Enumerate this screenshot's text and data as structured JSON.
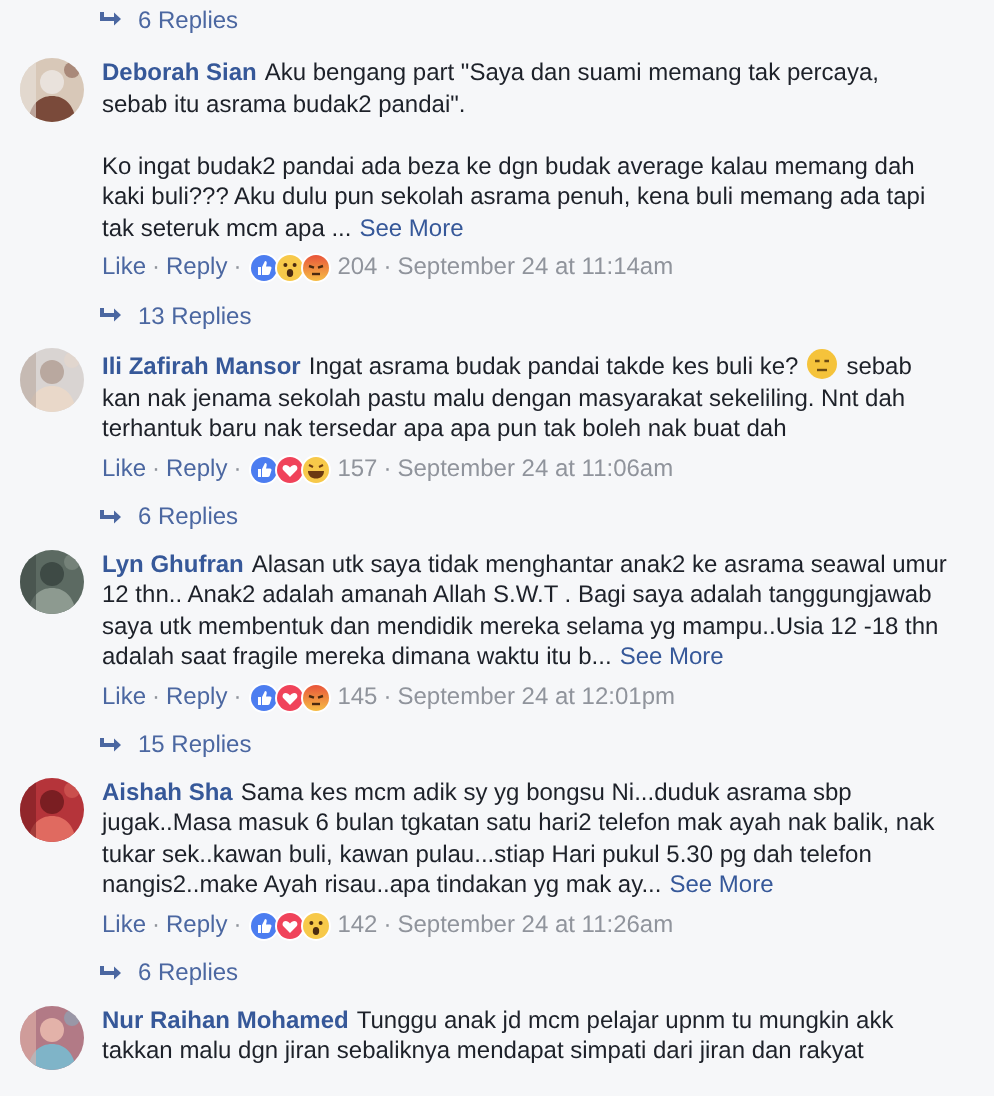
{
  "top_replies": {
    "label": "6 Replies"
  },
  "comments": [
    {
      "author": "Deborah Sian",
      "avatar": {
        "kind": "picture"
      },
      "paragraphs": [
        [
          {
            "kind": "text",
            "text": "Aku bengang part \"Saya dan suami memang tak percaya, sebab itu asrama budak2 pandai\"."
          }
        ],
        [
          {
            "kind": "text",
            "text": "Ko ingat budak2 pandai ada beza ke dgn budak average kalau memang dah kaki buli??? Aku dulu pun sekolah asrama penuh, kena buli memang ada tapi tak seteruk mcm apa ..."
          },
          {
            "kind": "link",
            "text": "See More"
          }
        ]
      ],
      "meta": [
        {
          "kind": "link",
          "text": "Like"
        },
        {
          "kind": "dot",
          "text": "·"
        },
        {
          "kind": "link",
          "text": "Reply"
        },
        {
          "kind": "dot",
          "text": "·"
        },
        {
          "kind": "reactions",
          "icons": [
            {
              "kind": "like"
            },
            {
              "kind": "wow"
            },
            {
              "kind": "angry"
            }
          ],
          "count": "204"
        },
        {
          "kind": "dot",
          "text": "·"
        },
        {
          "kind": "time",
          "text": "September 24 at 11:14am"
        }
      ],
      "replies": "13 Replies"
    },
    {
      "author": "Ili Zafirah Mansor",
      "avatar": {
        "kind": "picture"
      },
      "paragraphs": [
        [
          {
            "kind": "text",
            "text": "Ingat asrama budak pandai takde kes buli ke?"
          },
          {
            "kind": "emoji"
          },
          {
            "kind": "text",
            "text": "sebab kan nak jenama sekolah pastu malu dengan masyarakat sekeliling. Nnt dah terhantuk baru nak tersedar apa apa pun tak boleh nak buat dah"
          }
        ]
      ],
      "meta": [
        {
          "kind": "link",
          "text": "Like"
        },
        {
          "kind": "dot",
          "text": "·"
        },
        {
          "kind": "link",
          "text": "Reply"
        },
        {
          "kind": "dot",
          "text": "·"
        },
        {
          "kind": "reactions",
          "icons": [
            {
              "kind": "like"
            },
            {
              "kind": "love"
            },
            {
              "kind": "haha"
            }
          ],
          "count": "157"
        },
        {
          "kind": "dot",
          "text": "·"
        },
        {
          "kind": "time",
          "text": "September 24 at 11:06am"
        }
      ],
      "replies": "6 Replies"
    },
    {
      "author": "Lyn Ghufran",
      "avatar": {
        "kind": "picture"
      },
      "paragraphs": [
        [
          {
            "kind": "text",
            "text": "Alasan utk saya tidak menghantar anak2 ke asrama seawal umur 12 thn.. Anak2 adalah amanah Allah S.W.T . Bagi saya adalah tanggungjawab saya utk membentuk dan mendidik mereka selama yg mampu..Usia 12 -18 thn adalah saat fragile mereka dimana waktu itu b..."
          },
          {
            "kind": "link",
            "text": "See More"
          }
        ]
      ],
      "meta": [
        {
          "kind": "link",
          "text": "Like"
        },
        {
          "kind": "dot",
          "text": "·"
        },
        {
          "kind": "link",
          "text": "Reply"
        },
        {
          "kind": "dot",
          "text": "·"
        },
        {
          "kind": "reactions",
          "icons": [
            {
              "kind": "like"
            },
            {
              "kind": "love"
            },
            {
              "kind": "angry"
            }
          ],
          "count": "145"
        },
        {
          "kind": "dot",
          "text": "·"
        },
        {
          "kind": "time",
          "text": "September 24 at 12:01pm"
        }
      ],
      "replies": "15 Replies"
    },
    {
      "author": "Aishah Sha",
      "avatar": {
        "kind": "picture"
      },
      "paragraphs": [
        [
          {
            "kind": "text",
            "text": "Sama kes mcm adik sy yg bongsu Ni...duduk asrama sbp jugak..Masa masuk 6 bulan tgkatan satu hari2 telefon mak ayah nak balik, nak tukar sek..kawan buli, kawan pulau...stiap Hari pukul 5.30 pg dah telefon nangis2..make Ayah risau..apa tindakan yg mak ay..."
          },
          {
            "kind": "link",
            "text": "See More"
          }
        ]
      ],
      "meta": [
        {
          "kind": "link",
          "text": "Like"
        },
        {
          "kind": "dot",
          "text": "·"
        },
        {
          "kind": "link",
          "text": "Reply"
        },
        {
          "kind": "dot",
          "text": "·"
        },
        {
          "kind": "reactions",
          "icons": [
            {
              "kind": "like"
            },
            {
              "kind": "love"
            },
            {
              "kind": "wow"
            }
          ],
          "count": "142"
        },
        {
          "kind": "dot",
          "text": "·"
        },
        {
          "kind": "time",
          "text": "September 24 at 11:26am"
        }
      ],
      "replies": "6 Replies"
    },
    {
      "author": "Nur Raihan Mohamed",
      "avatar": {
        "kind": "picture"
      },
      "paragraphs": [
        [
          {
            "kind": "text",
            "text": "Tunggu anak jd mcm pelajar upnm tu mungkin akk takkan malu dgn jiran sebaliknya mendapat simpati dari jiran dan rakyat"
          }
        ]
      ]
    }
  ]
}
